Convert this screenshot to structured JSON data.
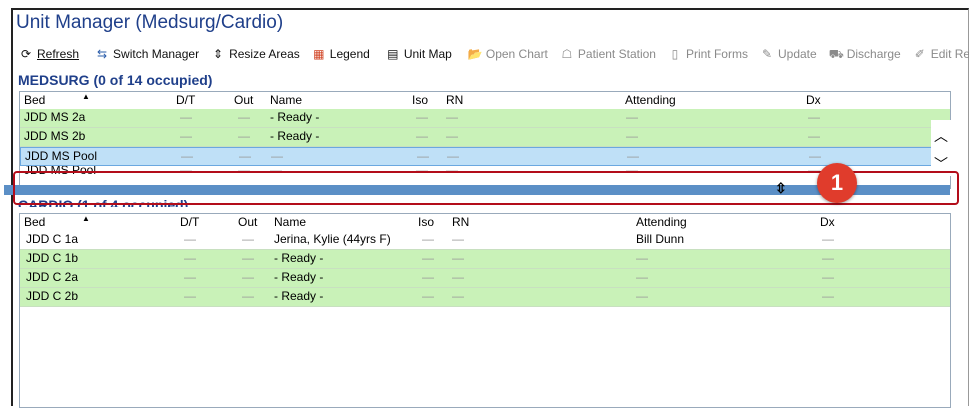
{
  "window": {
    "title": "Unit Manager (Medsurg/Cardio)"
  },
  "toolbar": {
    "refresh": "Refresh",
    "switch_manager": "Switch Manager",
    "resize_areas": "Resize Areas",
    "legend": "Legend",
    "unit_map": "Unit Map",
    "open_chart": "Open Chart",
    "patient_station": "Patient Station",
    "print_forms": "Print Forms",
    "update": "Update",
    "discharge": "Discharge",
    "edit_rec": "Edit Rec"
  },
  "columns": {
    "bed": "Bed",
    "dt": "D/T",
    "out": "Out",
    "name": "Name",
    "iso": "Iso",
    "rn": "RN",
    "attending": "Attending",
    "dx": "Dx"
  },
  "dash": "—",
  "medsurg": {
    "title": "MEDSURG (0 of 14 occupied)",
    "rows": [
      {
        "bed": "JDD MS 2a",
        "name": "- Ready -",
        "attending": ""
      },
      {
        "bed": "JDD MS 2b",
        "name": "- Ready -",
        "attending": ""
      },
      {
        "bed": "JDD MS Pool",
        "name": "—",
        "attending": ""
      },
      {
        "bed": "JDD MS Pool",
        "name": "—",
        "attending": ""
      }
    ]
  },
  "cardio": {
    "title": "CARDIO (1 of 4 occupied)",
    "rows": [
      {
        "bed": "JDD C 1a",
        "name": "Jerina, Kylie (44yrs F)",
        "attending": "Bill Dunn"
      },
      {
        "bed": "JDD C 1b",
        "name": "- Ready -",
        "attending": "—"
      },
      {
        "bed": "JDD C 2a",
        "name": "- Ready -",
        "attending": "—"
      },
      {
        "bed": "JDD C 2b",
        "name": "- Ready -",
        "attending": "—"
      }
    ]
  },
  "callout": {
    "number": "1"
  },
  "colors": {
    "title_blue": "#1f3f8a",
    "ready_green": "#c9f2b8",
    "selected_blue": "#bfe0f7",
    "splitter_blue": "#5b8fc6",
    "callout_red": "#e03c2c"
  }
}
